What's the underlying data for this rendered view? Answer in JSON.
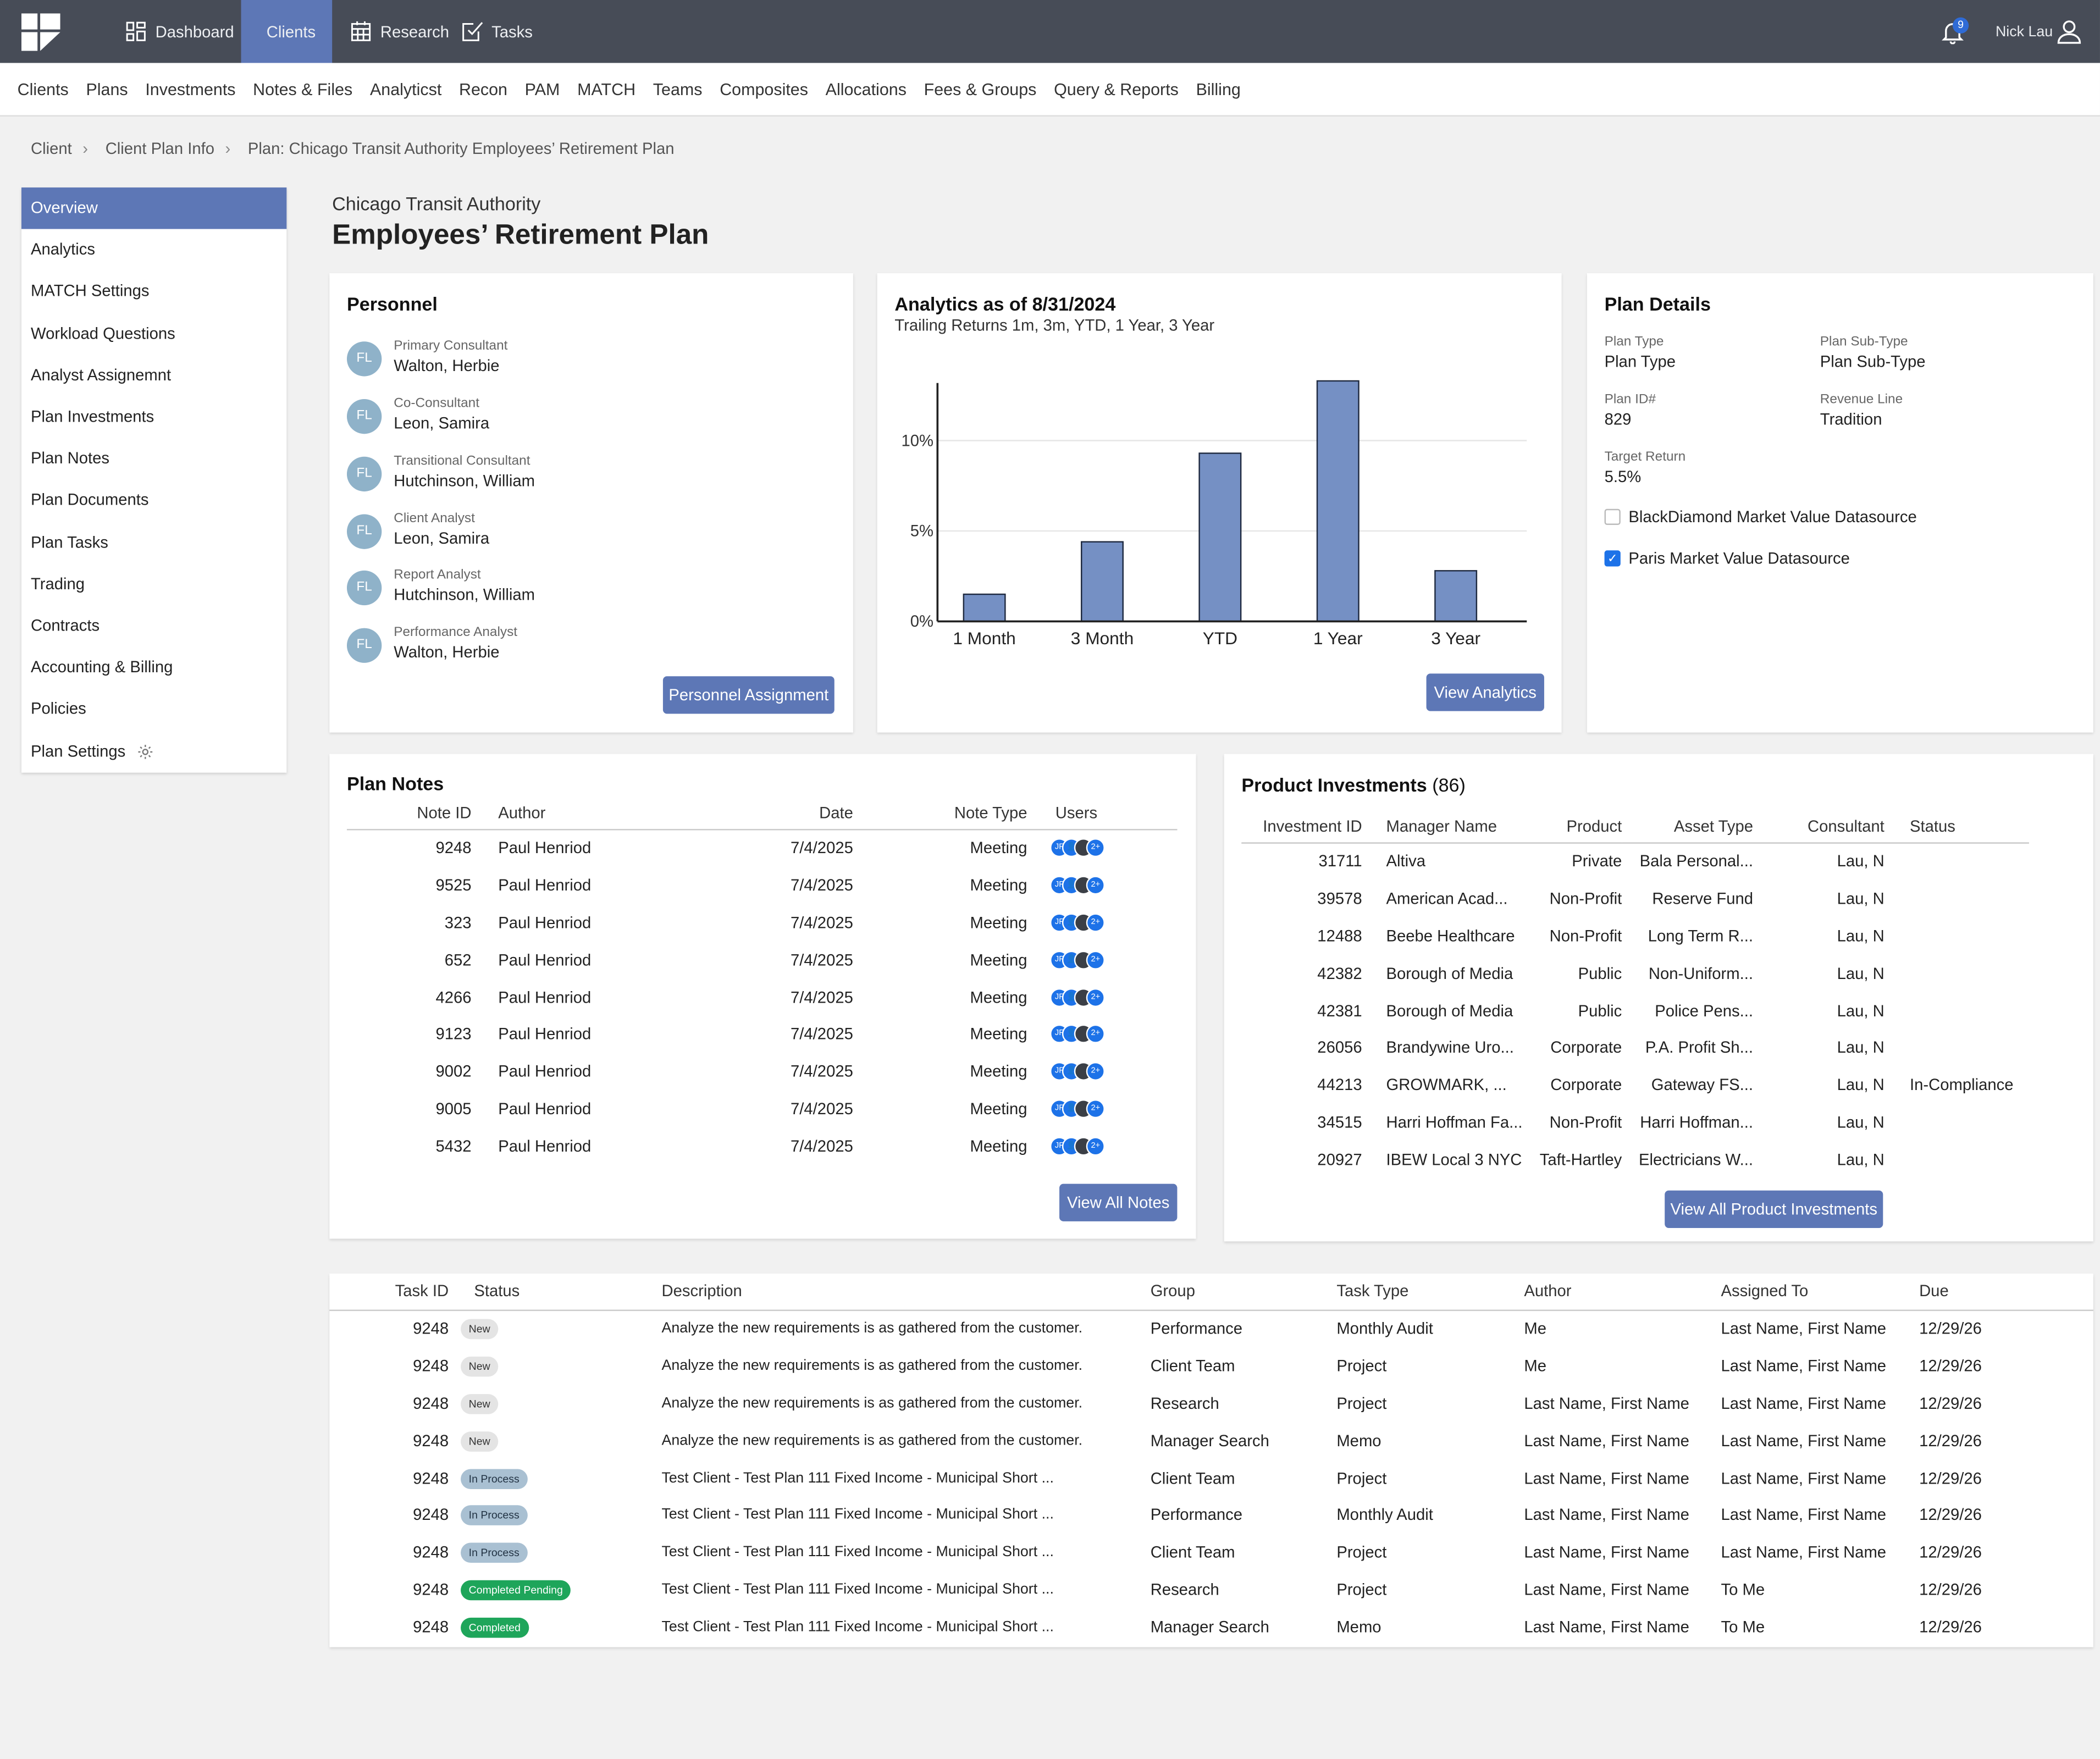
{
  "topnav": {
    "items": [
      {
        "label": "Dashboard",
        "icon": "grid-icon"
      },
      {
        "label": "Clients",
        "icon": "users-icon"
      },
      {
        "label": "Research",
        "icon": "calendar-grid-icon"
      },
      {
        "label": "Tasks",
        "icon": "checklist-icon"
      }
    ],
    "notifications_count": "9",
    "user_name": "Nick Lau"
  },
  "subnav": [
    "Clients",
    "Plans",
    "Investments",
    "Notes & Files",
    "Analyticst",
    "Recon",
    "PAM",
    "MATCH",
    "Teams",
    "Composites",
    "Allocations",
    "Fees & Groups",
    "Query & Reports",
    "Billing"
  ],
  "breadcrumb": [
    "Client",
    "Client Plan Info",
    "Plan: Chicago Transit Authority Employees’ Retirement Plan"
  ],
  "sidebar": [
    "Overview",
    "Analytics",
    "MATCH Settings",
    "Workload Questions",
    "Analyst Assignemnt",
    "Plan Investments",
    "Plan Notes",
    "Plan Documents",
    "Plan Tasks",
    "Trading",
    "Contracts",
    "Accounting & Billing",
    "Policies",
    "Plan Settings"
  ],
  "header": {
    "client": "Chicago Transit Authority",
    "plan": "Employees’ Retirement Plan"
  },
  "personnel": {
    "title": "Personnel",
    "button": "Personnel Assignment",
    "people": [
      {
        "initials": "FL",
        "role": "Primary Consultant",
        "name": "Walton, Herbie"
      },
      {
        "initials": "FL",
        "role": "Co-Consultant",
        "name": "Leon, Samira"
      },
      {
        "initials": "FL",
        "role": "Transitional Consultant",
        "name": "Hutchinson, William"
      },
      {
        "initials": "FL",
        "role": "Client Analyst",
        "name": "Leon, Samira"
      },
      {
        "initials": "FL",
        "role": "Report Analyst",
        "name": "Hutchinson, William"
      },
      {
        "initials": "FL",
        "role": "Performance Analyst",
        "name": "Walton, Herbie"
      }
    ]
  },
  "analytics": {
    "title": "Analytics as of 8/31/2024",
    "subtitle": "Trailing Returns 1m, 3m, YTD, 1 Year, 3 Year",
    "button": "View Analytics"
  },
  "chart_data": {
    "type": "bar",
    "categories": [
      "1 Month",
      "3 Month",
      "YTD",
      "1 Year",
      "3 Year"
    ],
    "values": [
      1.5,
      4.4,
      9.3,
      13.3,
      2.8
    ],
    "yticks": [
      "0%",
      "5%",
      "10%"
    ],
    "ylim": [
      0,
      13.5
    ],
    "grid": true,
    "bar_color": "#7590c4"
  },
  "plan_details": {
    "title": "Plan Details",
    "fields": [
      {
        "label": "Plan Type",
        "value": "Plan Type"
      },
      {
        "label": "Plan Sub-Type",
        "value": "Plan Sub-Type"
      },
      {
        "label": "Plan ID#",
        "value": "829"
      },
      {
        "label": "Revenue Line",
        "value": "Tradition"
      },
      {
        "label": "Target Return",
        "value": "5.5%"
      }
    ],
    "checkboxes": [
      {
        "label": "BlackDiamond Market Value Datasource",
        "checked": false
      },
      {
        "label": "Paris Market Value Datasource",
        "checked": true
      }
    ]
  },
  "plan_notes": {
    "title": "Plan Notes",
    "columns": [
      "Note ID",
      "Author",
      "Date",
      "Note Type",
      "Users"
    ],
    "rows": [
      [
        "9248",
        "Paul Henriod",
        "7/4/2025",
        "Meeting"
      ],
      [
        "9525",
        "Paul Henriod",
        "7/4/2025",
        "Meeting"
      ],
      [
        "323",
        "Paul Henriod",
        "7/4/2025",
        "Meeting"
      ],
      [
        "652",
        "Paul Henriod",
        "7/4/2025",
        "Meeting"
      ],
      [
        "4266",
        "Paul Henriod",
        "7/4/2025",
        "Meeting"
      ],
      [
        "9123",
        "Paul Henriod",
        "7/4/2025",
        "Meeting"
      ],
      [
        "9002",
        "Paul Henriod",
        "7/4/2025",
        "Meeting"
      ],
      [
        "9005",
        "Paul Henriod",
        "7/4/2025",
        "Meeting"
      ],
      [
        "5432",
        "Paul Henriod",
        "7/4/2025",
        "Meeting"
      ]
    ],
    "users_more": "2+",
    "button": "View All Notes"
  },
  "product_investments": {
    "title": "Product Investments",
    "count": "(86)",
    "columns": [
      "Investment ID",
      "Manager Name",
      "Product",
      "Asset Type",
      "Consultant",
      "Status"
    ],
    "rows": [
      [
        "31711",
        "Altiva",
        "Private",
        "Bala Personal...",
        "Lau, N",
        ""
      ],
      [
        "39578",
        "American Acad...",
        "Non-Profit",
        "Reserve Fund",
        "Lau, N",
        ""
      ],
      [
        "12488",
        "Beebe Healthcare",
        "Non-Profit",
        "Long Term R...",
        "Lau, N",
        ""
      ],
      [
        "42382",
        "Borough of Media",
        "Public",
        "Non-Uniform...",
        "Lau, N",
        ""
      ],
      [
        "42381",
        "Borough of Media",
        "Public",
        "Police Pens...",
        "Lau, N",
        ""
      ],
      [
        "26056",
        "Brandywine Uro...",
        "Corporate",
        "P.A. Profit Sh...",
        "Lau, N",
        ""
      ],
      [
        "44213",
        "GROWMARK, ...",
        "Corporate",
        "Gateway FS...",
        "Lau, N",
        "In-Compliance"
      ],
      [
        "34515",
        "Harri Hoffman Fa...",
        "Non-Profit",
        "Harri Hoffman...",
        "Lau, N",
        ""
      ],
      [
        "20927",
        "IBEW Local 3 NYC",
        "Taft-Hartley",
        "Electricians W...",
        "Lau, N",
        ""
      ]
    ],
    "button": "View All Product Investments"
  },
  "tasks": {
    "columns": [
      "Task ID",
      "Status",
      "Description",
      "Group",
      "Task Type",
      "Author",
      "Assigned To",
      "Due"
    ],
    "rows": [
      [
        "9248",
        "New",
        "Analyze the new requirements is as gathered from the customer.",
        "Performance",
        "Monthly Audit",
        "Me",
        "Last Name, First Name",
        "12/29/26"
      ],
      [
        "9248",
        "New",
        "Analyze the new requirements is as gathered from the customer.",
        "Client Team",
        "Project",
        "Me",
        "Last Name, First Name",
        "12/29/26"
      ],
      [
        "9248",
        "New",
        "Analyze the new requirements is as gathered from the customer.",
        "Research",
        "Project",
        "Last Name, First Name",
        "Last Name, First Name",
        "12/29/26"
      ],
      [
        "9248",
        "New",
        "Analyze the new requirements is as gathered from the customer.",
        "Manager Search",
        "Memo",
        "Last Name, First Name",
        "Last Name, First Name",
        "12/29/26"
      ],
      [
        "9248",
        "In Process",
        "Test Client - Test Plan 111 Fixed Income - Municipal Short ...",
        "Client Team",
        "Project",
        "Last Name, First Name",
        "Last Name, First Name",
        "12/29/26"
      ],
      [
        "9248",
        "In Process",
        "Test Client - Test Plan 111 Fixed Income - Municipal Short ...",
        "Performance",
        "Monthly Audit",
        "Last Name, First Name",
        "Last Name, First Name",
        "12/29/26"
      ],
      [
        "9248",
        "In Process",
        "Test Client - Test Plan 111 Fixed Income - Municipal Short ...",
        "Client Team",
        "Project",
        "Last Name, First Name",
        "Last Name, First Name",
        "12/29/26"
      ],
      [
        "9248",
        "Completed Pending",
        "Test Client - Test Plan 111 Fixed Income - Municipal Short ...",
        "Research",
        "Project",
        "Last Name, First Name",
        "To Me",
        "12/29/26"
      ],
      [
        "9248",
        "Completed",
        "Test Client - Test Plan 111 Fixed Income - Municipal Short ...",
        "Manager Search",
        "Memo",
        "Last Name, First Name",
        "To Me",
        "12/29/26"
      ]
    ]
  }
}
